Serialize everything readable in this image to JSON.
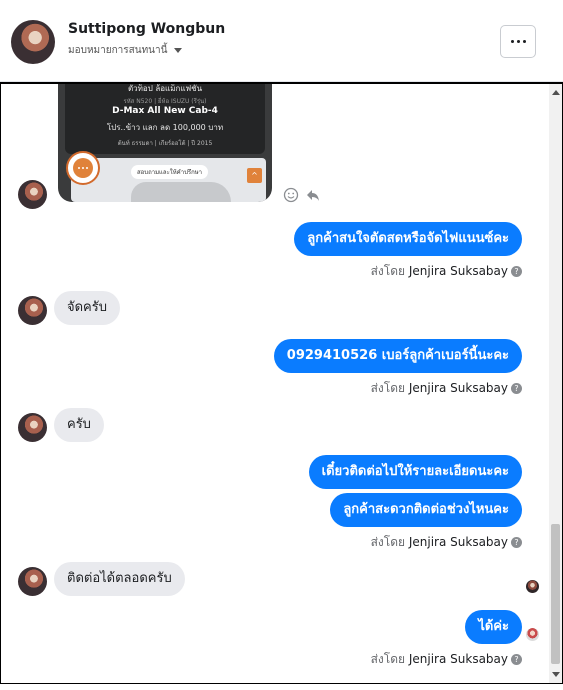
{
  "header": {
    "name": "Suttipong Wongbun",
    "assign": "มอบหมายการสนทนานี้"
  },
  "ad": {
    "promo": "ตัวท็อป ล้อแม็กแฟชั่น",
    "spec": "รหัส N520 | ยี่ห้อ ISUZU (รีรุ่น)",
    "model": "D-Max All New Cab-4",
    "offer": "โปร..ข้าว แลก ลด 100,000 บาท",
    "meta": "ต้นท์ ธรรมดา | เกียร์ออโต้ | ปี 2015",
    "cta": "สอบถามและให้คำปรึกษา"
  },
  "messages": [
    {
      "dir": "out",
      "text": "ลูกค้าสนใจตัดสดหรือจัดไฟแนนซ์คะ"
    },
    {
      "dir": "meta",
      "prefix": "ส่งโดย",
      "agent": "Jenjira Suksabay"
    },
    {
      "dir": "in",
      "text": "จัดครับ"
    },
    {
      "dir": "out",
      "text": "0929410526 เบอร์ลูกค้าเบอร์นี้นะคะ"
    },
    {
      "dir": "meta",
      "prefix": "ส่งโดย",
      "agent": "Jenjira Suksabay"
    },
    {
      "dir": "in",
      "text": "ครับ"
    },
    {
      "dir": "out",
      "text": "เดี๋ยวติดต่อไปให้รายละเอียดนะคะ"
    },
    {
      "dir": "out",
      "text": "ลูกค้าสะดวกติดต่อช่วงไหนคะ"
    },
    {
      "dir": "meta",
      "prefix": "ส่งโดย",
      "agent": "Jenjira Suksabay"
    },
    {
      "dir": "in",
      "text": "ติดต่อได้ตลอดครับ"
    },
    {
      "dir": "out",
      "text": "ได้ค่ะ"
    },
    {
      "dir": "meta",
      "prefix": "ส่งโดย",
      "agent": "Jenjira Suksabay"
    }
  ],
  "icons": {
    "more": "more-options-icon",
    "info": "info-icon",
    "emoji": "emoji-icon",
    "reply": "reply-icon",
    "assign_caret": "chevron-down-icon"
  },
  "colors": {
    "outgoing_bubble": "#0a7cff",
    "incoming_bubble": "#e9eaee"
  }
}
